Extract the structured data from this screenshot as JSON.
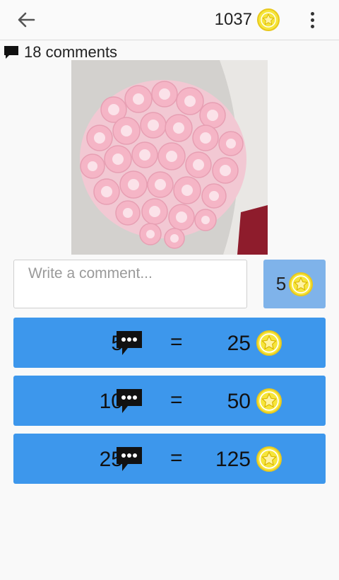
{
  "header": {
    "coins": "1037",
    "back_icon": "arrow-left-icon",
    "menu_icon": "more-vertical-icon",
    "coin_color": "#f6e53a"
  },
  "comments": {
    "count_label": "18 comments"
  },
  "composer": {
    "placeholder": "Write a comment...",
    "cost": "5"
  },
  "packages": [
    {
      "comments": "5",
      "equals": "=",
      "price": "25"
    },
    {
      "comments": "10",
      "equals": "=",
      "price": "50"
    },
    {
      "comments": "25",
      "equals": "=",
      "price": "125"
    }
  ],
  "colors": {
    "package_bg": "#3d97ec",
    "send_bg": "#7fb3ea"
  }
}
